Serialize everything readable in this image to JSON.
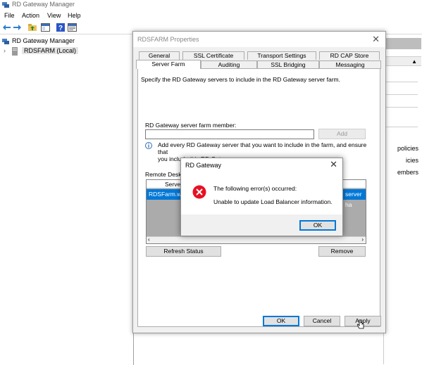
{
  "app": {
    "title": "RD Gateway Manager"
  },
  "menu": [
    "File",
    "Action",
    "View",
    "Help"
  ],
  "toolbar": {
    "icons": [
      "back-arrow-icon",
      "forward-arrow-icon",
      "folder-up-icon",
      "console-tree-icon",
      "help-icon",
      "properties-icon"
    ]
  },
  "tree": {
    "root": "RD Gateway Manager",
    "child": "RDSFARM (Local)"
  },
  "actions_pane": {
    "visible_items": [
      "policies",
      "icies",
      "embers"
    ]
  },
  "properties_dialog": {
    "title": "RDSFARM Properties",
    "tabs_row1": [
      "General",
      "SSL Certificate",
      "Transport Settings",
      "RD CAP Store"
    ],
    "tabs_row2": [
      "Server Farm",
      "Auditing",
      "SSL Bridging",
      "Messaging"
    ],
    "active_tab": "Server Farm",
    "description": "Specify the RD Gateway servers to include in the RD Gateway server farm.",
    "member_label": "RD Gateway server farm member:",
    "member_value": "",
    "add_button": "Add",
    "info_text_line1": "Add every RD Gateway server that you want to include in the farm, and ensure that",
    "info_text_line2": "you include this RD Gateway server.",
    "list_label": "Remote Deskto",
    "grid": {
      "header_left": "Server",
      "row_left": "RDSFarm.win",
      "row_right": "server ha"
    },
    "refresh_button": "Refresh Status",
    "remove_button": "Remove",
    "ok_button": "OK",
    "cancel_button": "Cancel",
    "apply_button": "Apply"
  },
  "error_dialog": {
    "title": "RD Gateway",
    "message_line1": "The following error(s) occurred:",
    "message_line2": "Unable to update Load Balancer information.",
    "ok_button": "OK"
  },
  "colors": {
    "selection": "#0078d7",
    "error_icon": "#e81123",
    "grid_background": "#ababab"
  }
}
